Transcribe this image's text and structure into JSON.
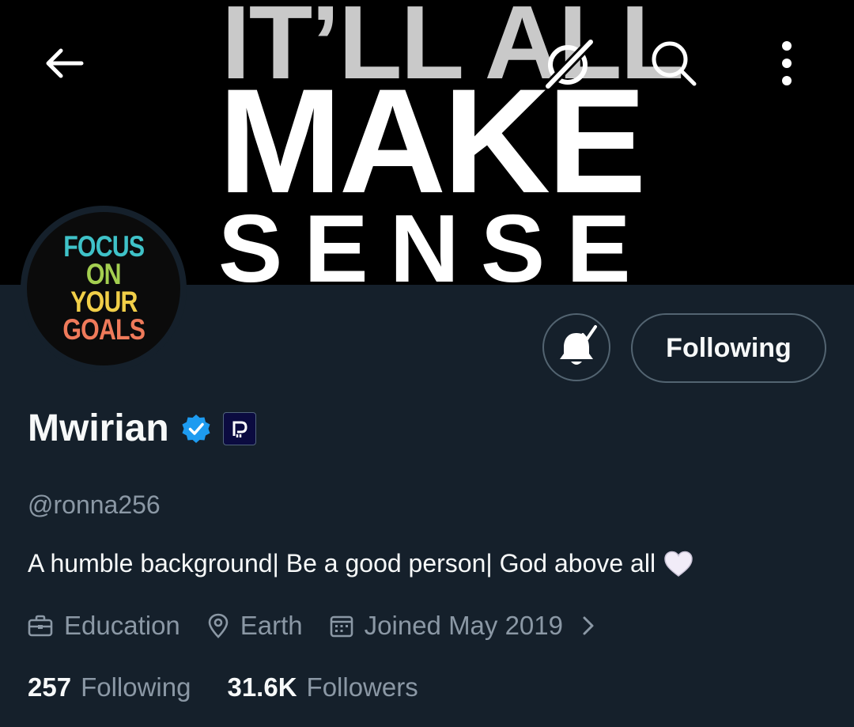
{
  "banner": {
    "line1": "IT’LL ALL",
    "line2": "MAKE",
    "line3": "SENSE"
  },
  "header_icons": {
    "back": "arrow-left-icon",
    "grok": "grok-icon",
    "search": "search-icon",
    "more": "more-vertical-icon"
  },
  "avatar": {
    "lines": [
      "FOCUS",
      "ON",
      "YOUR",
      "GOALS"
    ]
  },
  "actions": {
    "notifications_icon": "bell-check-icon",
    "following_label": "Following"
  },
  "profile": {
    "display_name": "Mwirian",
    "handle": "@ronna256",
    "bio": "A humble background| Be a good person| God above all",
    "bio_emoji": "white-heart",
    "verified_color": "#1d9bf0"
  },
  "meta": {
    "category": "Education",
    "location": "Earth",
    "joined": "Joined May 2019"
  },
  "stats": {
    "following_count": "257",
    "following_label": "Following",
    "followers_count": "31.6K",
    "followers_label": "Followers"
  },
  "colors": {
    "background": "#15202b",
    "text_primary": "#f7f9f9",
    "text_secondary": "#8b98a5",
    "border": "#536471"
  }
}
